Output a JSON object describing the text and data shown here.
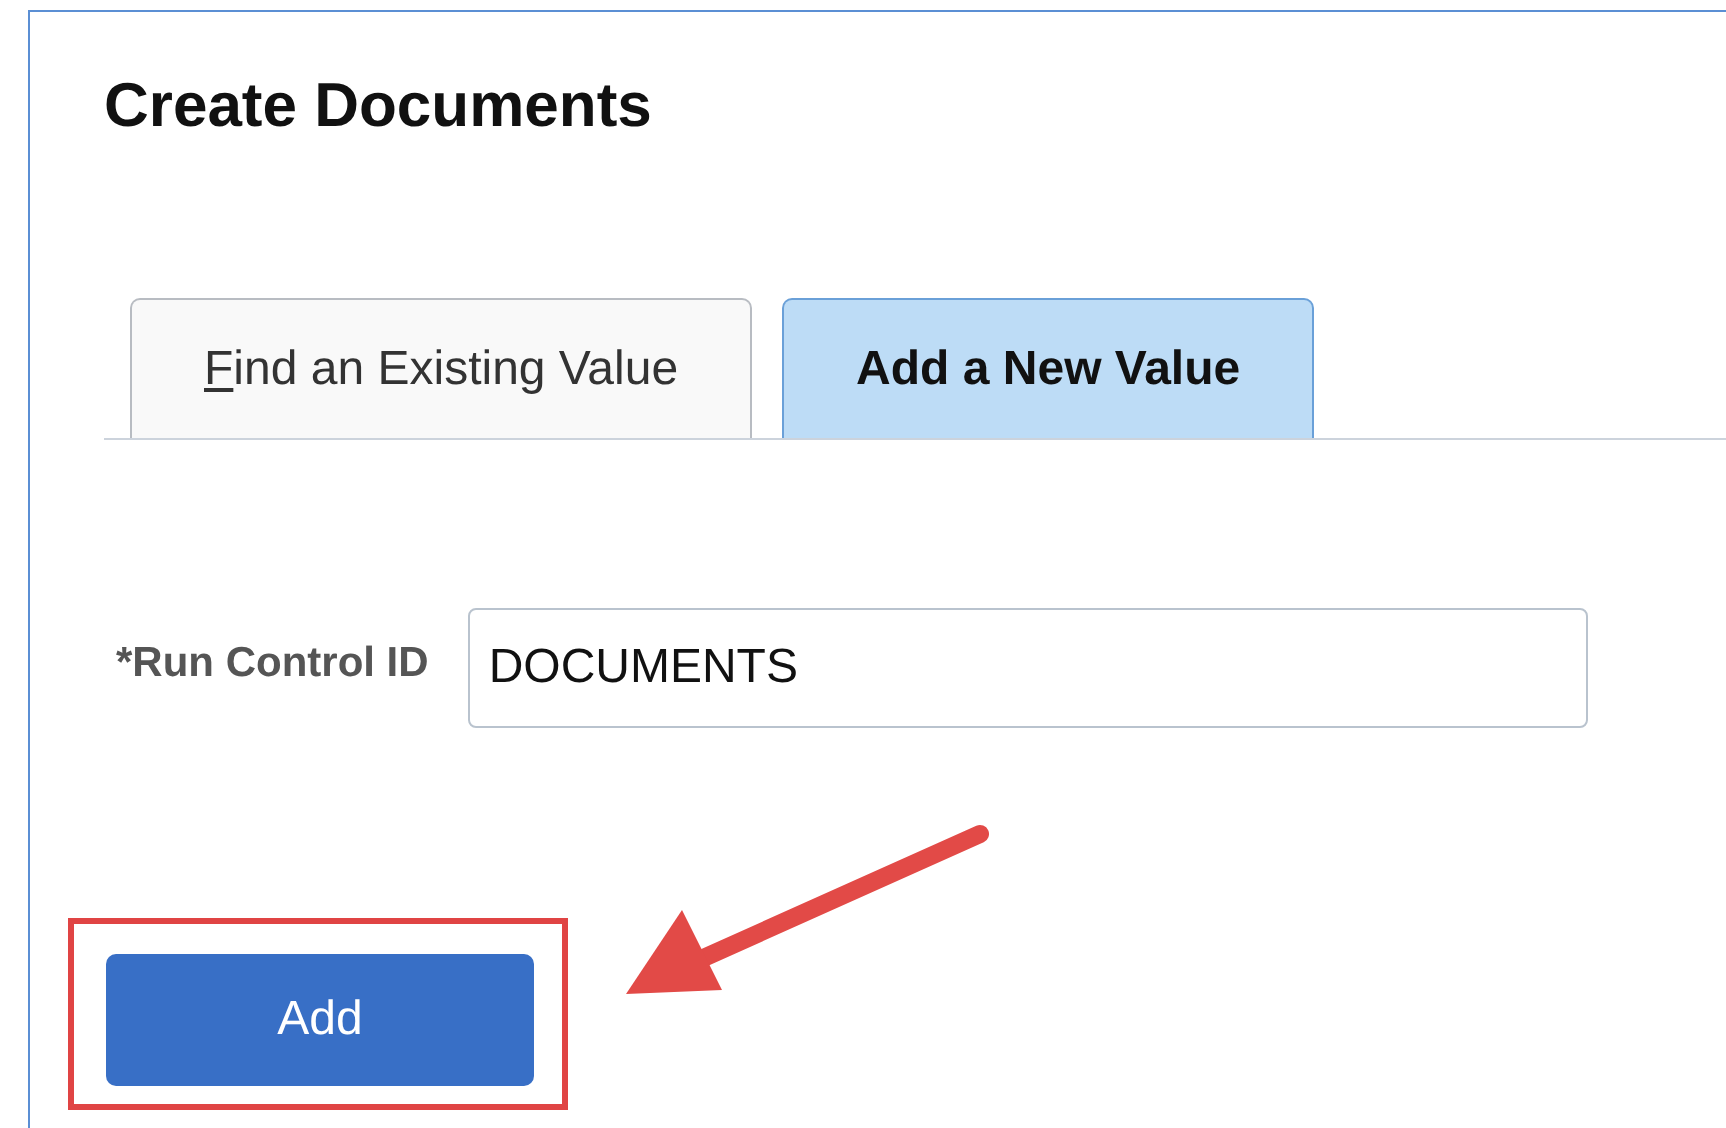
{
  "title": "Create Documents",
  "tabs": [
    {
      "label": "Find an Existing Value",
      "selected": false,
      "mnemonic": true
    },
    {
      "label": "Add a New Value",
      "selected": true,
      "mnemonic": false
    }
  ],
  "field": {
    "label": "*Run Control ID",
    "value": "DOCUMENTS"
  },
  "button": {
    "label": "Add",
    "highlighted": true
  },
  "annotation": {
    "arrow": true
  }
}
